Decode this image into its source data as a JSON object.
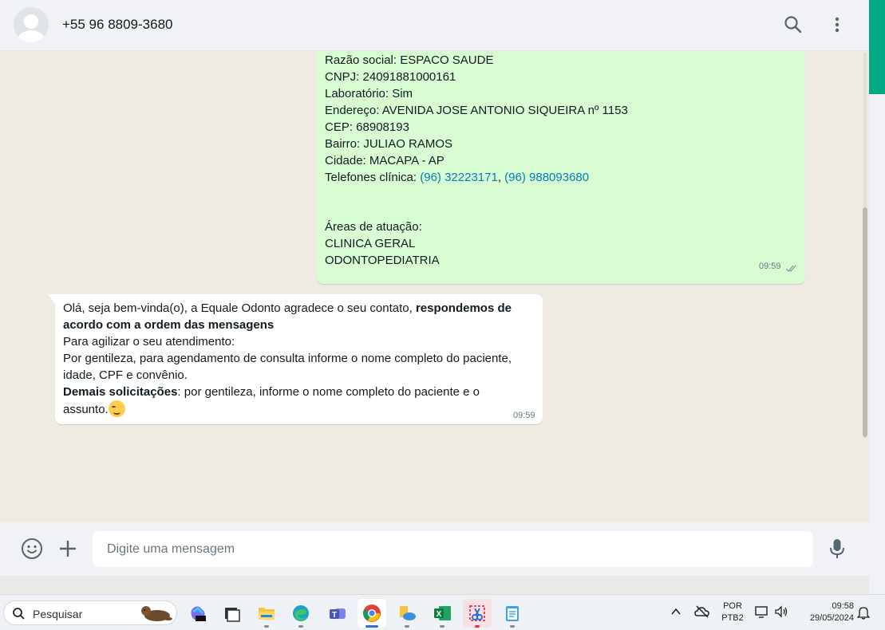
{
  "header": {
    "contact_name": "+55 96 8809-3680",
    "icons": [
      "avatar",
      "search-icon",
      "menu-icon"
    ]
  },
  "messages": {
    "outgoing": {
      "lines": {
        "razao": "Razão social: ESPACO SAUDE",
        "cnpj": "CNPJ: 24091881000161",
        "lab": "Laboratório: Sim",
        "endereco": "Endereço: AVENIDA JOSE ANTONIO SIQUEIRA nº 1153",
        "cep": "CEP: 68908193",
        "bairro": "Bairro: JULIAO RAMOS",
        "cidade": "Cidade: MACAPA - AP",
        "telefones_label": "Telefones clínica: ",
        "telefone_1": "(96) 32223171",
        "telefone_sep": ", ",
        "telefone_2": "(96) 988093680",
        "areas": "Áreas de atuação:",
        "area_1": "CLINICA GERAL",
        "area_2": "ODONTOPEDIATRIA"
      },
      "time": "09:59",
      "status": "read"
    },
    "incoming": {
      "line1_normal": "Olá, seja bem-vinda(o), a Equale Odonto agradece o seu contato, ",
      "line1_bold": "respondemos de",
      "line2_bold": "acordo com a ordem das mensagens",
      "line3": "Para agilizar o seu atendimento:",
      "line4": "Por gentileza, para agendamento de consulta informe o nome completo do paciente,",
      "line5": "idade, CPF e convênio.",
      "line6_bold": "Demais solicitações",
      "line6_normal": ": por gentileza, informe o nome completo do paciente e o",
      "line7": "assunto.",
      "emoji": "smiling-face-emoji",
      "time": "09:59"
    }
  },
  "composer": {
    "placeholder": "Digite uma mensagem",
    "icons": [
      "emoji-icon",
      "plus-icon",
      "mic-icon"
    ]
  },
  "taskbar": {
    "search_placeholder": "Pesquisar",
    "apps": [
      "copilot",
      "task-view",
      "file-explorer",
      "edge",
      "teams",
      "chrome",
      "onedrive",
      "excel",
      "snipping-tool",
      "notepad"
    ],
    "active_app": "chrome",
    "tray": {
      "lang_top": "POR",
      "lang_bottom": "PTB2",
      "time": "09:58",
      "date": "29/05/2024"
    }
  },
  "colors": {
    "outgoing_bubble": "#d9fdd3",
    "incoming_bubble": "#ffffff",
    "chat_background": "#efeae2",
    "link": "#027eb5",
    "accent": "#00a884"
  }
}
